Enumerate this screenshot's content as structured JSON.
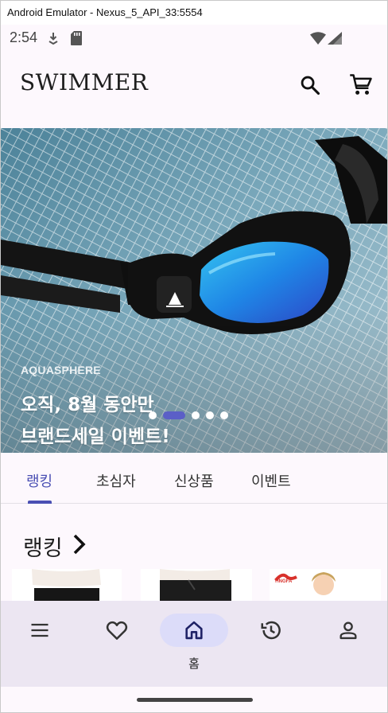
{
  "emulator": {
    "title": "Android Emulator - Nexus_5_API_33:5554"
  },
  "status_bar": {
    "time": "2:54"
  },
  "app_bar": {
    "logo": "SWIMMER",
    "icons": [
      "search-icon",
      "cart-icon"
    ]
  },
  "banner": {
    "brand": "AQUASPHERE",
    "line1": "오직, 8월 동안만",
    "line2": "브랜드세일 이벤트!",
    "slide_count": 5,
    "active_slide": 2
  },
  "tabs": [
    {
      "label": "랭킹",
      "active": true
    },
    {
      "label": "초심자",
      "active": false
    },
    {
      "label": "신상품",
      "active": false
    },
    {
      "label": "이벤트",
      "active": false
    }
  ],
  "section": {
    "title": "랭킹"
  },
  "product_badge": "YINGFA",
  "bottom_nav": [
    {
      "icon": "menu-icon",
      "label": ""
    },
    {
      "icon": "heart-icon",
      "label": ""
    },
    {
      "icon": "home-icon",
      "label": "홈",
      "active": true
    },
    {
      "icon": "history-icon",
      "label": ""
    },
    {
      "icon": "person-icon",
      "label": ""
    }
  ],
  "colors": {
    "accent": "#4a4fb3",
    "nav_background": "#ece6f2",
    "nav_active_pill": "#dcdcf9",
    "surface": "#fdf8fd"
  }
}
